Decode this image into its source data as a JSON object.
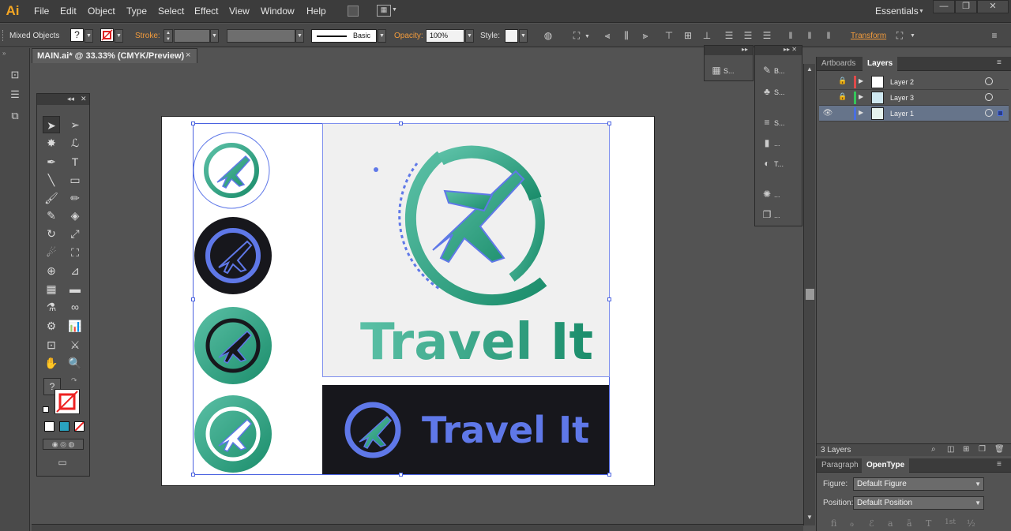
{
  "app": {
    "logo_text": "Ai"
  },
  "menu": [
    "File",
    "Edit",
    "Object",
    "Type",
    "Select",
    "Effect",
    "View",
    "Window",
    "Help"
  ],
  "workspace": {
    "label": "Essentials"
  },
  "control_bar": {
    "selection_label": "Mixed Objects",
    "fill_box_text": "?",
    "stroke_label": "Stroke:",
    "brush_label": "Basic",
    "opacity_label": "Opacity:",
    "opacity_value": "100%",
    "style_label": "Style:",
    "transform_label": "Transform"
  },
  "document_tab": {
    "title": "MAIN.ai* @ 33.33% (CMYK/Preview)",
    "close": "×"
  },
  "floating_panels": {
    "panel_a": [
      {
        "icon": "swatches-grid-icon",
        "glyph": "▦",
        "label": "S..."
      }
    ],
    "panel_b": [
      {
        "icon": "brushes-icon",
        "glyph": "✎",
        "label": "B..."
      },
      {
        "icon": "symbols-icon",
        "glyph": "♣",
        "label": "S..."
      },
      {
        "icon": "stroke-icon",
        "glyph": "≡",
        "label": "S..."
      },
      {
        "icon": "gradient-icon",
        "glyph": "▮",
        "label": "..."
      },
      {
        "icon": "transparency-icon",
        "glyph": "◐",
        "label": "T..."
      },
      {
        "icon": "appearance-icon",
        "glyph": "✺",
        "label": "..."
      },
      {
        "icon": "graphic-styles-icon",
        "glyph": "❐",
        "label": "..."
      }
    ]
  },
  "artwork": {
    "brand_text_large": "Travel It",
    "brand_text_small": "Travel It",
    "colors": {
      "gradient_start": "#5bc0a6",
      "gradient_end": "#1b8d6b",
      "path_outline": "#5f78e8",
      "dark_bg": "#17171c"
    }
  },
  "layers_panel": {
    "tabs": [
      "Artboards",
      "Layers"
    ],
    "active_tab": "Layers",
    "layers": [
      {
        "name": "Layer 2",
        "color": "#e04a4a",
        "locked": true,
        "visible": false,
        "selected": false
      },
      {
        "name": "Layer 3",
        "color": "#35c55a",
        "locked": true,
        "visible": false,
        "selected": false
      },
      {
        "name": "Layer 1",
        "color": "#4a6ee0",
        "locked": false,
        "visible": true,
        "selected": true
      }
    ],
    "footer_count": "3 Layers"
  },
  "opentype_panel": {
    "tabs": [
      "Paragraph",
      "OpenType"
    ],
    "active_tab": "OpenType",
    "figure_label": "Figure:",
    "figure_value": "Default Figure",
    "position_label": "Position:",
    "position_value": "Default Position",
    "glyph_buttons": [
      "ﬁ",
      "ℴ",
      "ℰ",
      "a",
      "ā",
      "T",
      "1st",
      "½"
    ]
  }
}
